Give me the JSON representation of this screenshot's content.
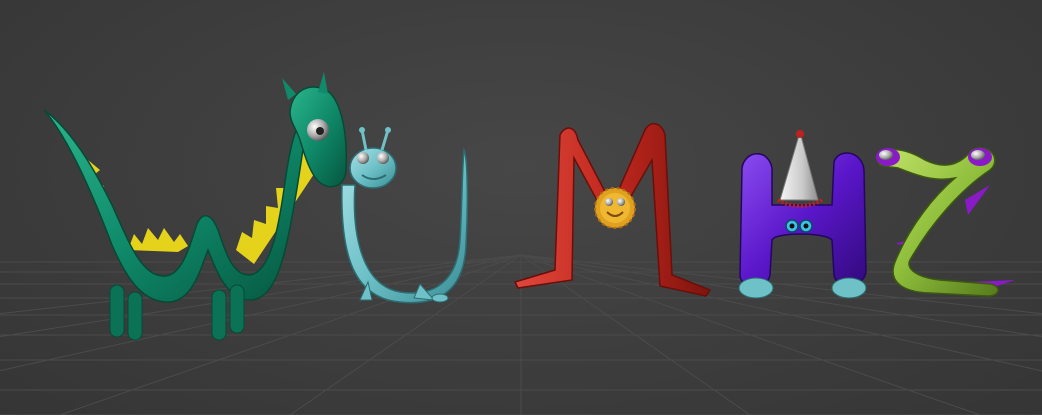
{
  "scene": {
    "background_color": "#3d3d3d",
    "grid_color": "#4a4a4a",
    "characters": [
      {
        "name": "W",
        "color": "#0f8a6a",
        "accent_color": "#e5d21a"
      },
      {
        "name": "U",
        "color": "#6fc1c8"
      },
      {
        "name": "M",
        "color": "#c0271e",
        "accent_color": "#e0a020"
      },
      {
        "name": "H",
        "color": "#5a16c9",
        "accent_color": "#d9d9d9"
      },
      {
        "name": "Z",
        "color": "#8fbf3c",
        "accent_color": "#8a1ac8"
      }
    ]
  }
}
